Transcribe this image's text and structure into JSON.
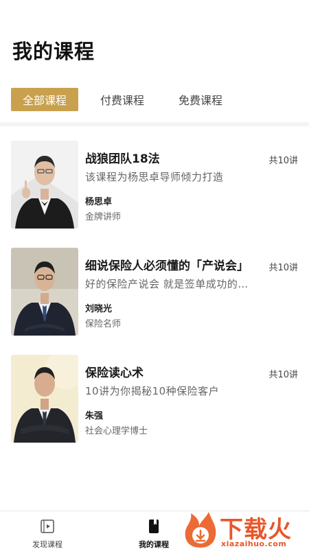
{
  "page": {
    "title": "我的课程"
  },
  "tabs": [
    {
      "label": "全部课程",
      "active": true
    },
    {
      "label": "付费课程",
      "active": false
    },
    {
      "label": "免费课程",
      "active": false
    }
  ],
  "courses": [
    {
      "title": "战狼团队18法",
      "count": "共10讲",
      "desc": "该课程为杨思卓导师倾力打造",
      "teacher": "杨思卓",
      "role": "金牌讲师"
    },
    {
      "title": "细说保险人必须懂的「产说会」",
      "count": "共10讲",
      "desc": "好的保险产说会 就是签单成功的…",
      "teacher": "刘晓光",
      "role": "保险名师"
    },
    {
      "title": "保险读心术",
      "count": "共10讲",
      "desc": "10讲为你揭秘10种保险客户",
      "teacher": "朱强",
      "role": "社会心理学博士"
    }
  ],
  "bottom_nav": [
    {
      "label": "发现课程",
      "icon": "play-video-icon",
      "active": false
    },
    {
      "label": "我的课程",
      "icon": "book-icon",
      "active": true
    }
  ],
  "watermark": {
    "text": "下载火",
    "url": "xiazaihuo.com"
  },
  "colors": {
    "accent": "#c9a14e",
    "watermark": "#e8562a"
  }
}
